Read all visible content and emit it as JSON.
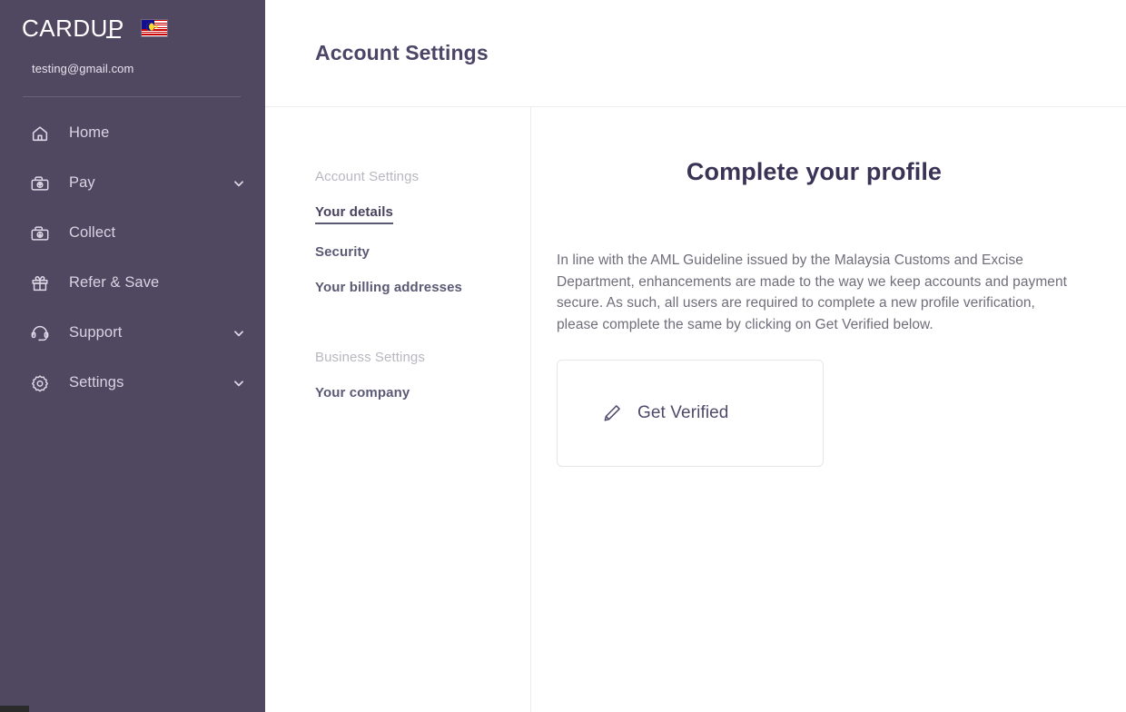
{
  "sidebar": {
    "logo": "CARDUP",
    "logo_icon": "cardup-logo",
    "flag_icon": "malaysia-flag-icon",
    "flag_name": "Malaysia",
    "email": "testing@gmail.com",
    "items": [
      {
        "label": "Home",
        "icon": "home-icon",
        "expandable": false
      },
      {
        "label": "Pay",
        "icon": "pay-wallet-up-icon",
        "expandable": true
      },
      {
        "label": "Collect",
        "icon": "collect-wallet-down-icon",
        "expandable": false
      },
      {
        "label": "Refer & Save",
        "icon": "gift-icon",
        "expandable": false
      },
      {
        "label": "Support",
        "icon": "headset-icon",
        "expandable": true
      },
      {
        "label": "Settings",
        "icon": "gear-icon",
        "expandable": true
      }
    ]
  },
  "header": {
    "title": "Account Settings"
  },
  "subnav": {
    "groups": [
      {
        "title": "Account Settings",
        "items": [
          {
            "label": "Your details",
            "active": true
          },
          {
            "label": "Security",
            "active": false
          },
          {
            "label": "Your billing addresses",
            "active": false
          }
        ]
      },
      {
        "title": "Business Settings",
        "items": [
          {
            "label": "Your company",
            "active": false
          }
        ]
      }
    ]
  },
  "main": {
    "title": "Complete your profile",
    "body": "In line with the AML Guideline issued by the Malaysia Customs and Excise Department, enhancements are made to the way we keep accounts and payment secure. As such, all users are required to complete a new profile verification, please complete the same by clicking on Get Verified below.",
    "verify_card": {
      "label": "Get Verified",
      "icon": "pencil-icon"
    }
  },
  "colors": {
    "sidebar_bg": "#504761",
    "sidebar_text": "#d9d4e2",
    "header_title": "#4c4566",
    "main_title": "#3b3355",
    "body_text": "#6f6e7a",
    "subnav_group": "#b9b7bf",
    "subnav_item": "#5b5a75",
    "card_border": "#e6e6ea",
    "divider": "#ededf0"
  }
}
